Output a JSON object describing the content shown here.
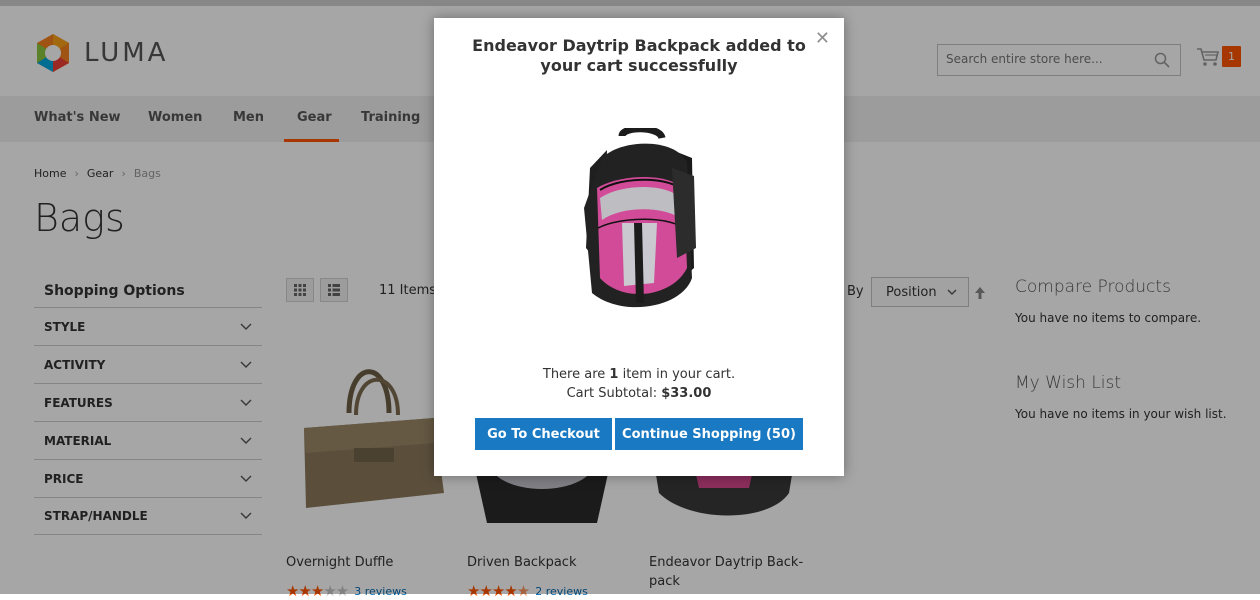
{
  "header": {
    "logo_text": "LUMA",
    "search_placeholder": "Search entire store here...",
    "cart_count": "1"
  },
  "nav": {
    "items": [
      "What's New",
      "Women",
      "Men",
      "Gear",
      "Training"
    ],
    "active": "Gear"
  },
  "breadcrumb": [
    "Home",
    "Gear",
    "Bags"
  ],
  "page_title": "Bags",
  "sidebar": {
    "title": "Shopping Options",
    "filters": [
      "STYLE",
      "ACTIVITY",
      "FEATURES",
      "MATERIAL",
      "PRICE",
      "STRAP/HANDLE"
    ]
  },
  "toolbar": {
    "amount": "11 Items",
    "sort_label": "By",
    "sort_value": "Position"
  },
  "products": [
    {
      "name": "Overnight Duffle",
      "rating": 3,
      "reviews": "3 reviews"
    },
    {
      "name": "Driven Backpack",
      "rating": 4.5,
      "reviews": "2 reviews"
    },
    {
      "name": "Endeavor Daytrip Back-pack",
      "rating": null,
      "reviews": ""
    }
  ],
  "compare": {
    "title": "Compare Products",
    "text": "You have no items to compare."
  },
  "wishlist": {
    "title": "My Wish List",
    "text": "You have no items in your wish list."
  },
  "modal": {
    "message": "Endeavor Daytrip Backpack added to your cart successfully",
    "count_prefix": "There are ",
    "count_value": "1",
    "count_suffix": " item in your cart.",
    "subtotal_label": "Cart Subtotal: ",
    "subtotal_value": "$33.00",
    "checkout_label": "Go To Checkout",
    "continue_label": "Continue Shopping (50)"
  },
  "colors": {
    "accent": "#ff5501",
    "button": "#1979c3",
    "link": "#006bb4"
  }
}
